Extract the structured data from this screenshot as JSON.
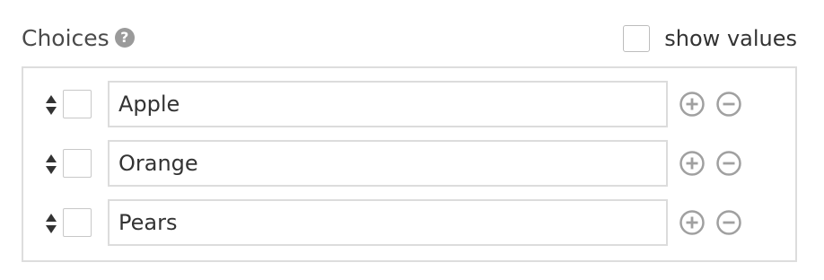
{
  "header": {
    "title": "Choices",
    "help_icon": "question-circle-icon"
  },
  "show_values": {
    "label": "show values",
    "checked": false
  },
  "choices": [
    {
      "value": "Apple",
      "checked": false
    },
    {
      "value": "Orange",
      "checked": false
    },
    {
      "value": "Pears",
      "checked": false
    }
  ],
  "icons": {
    "sort": "sort-icon",
    "add": "plus-circle-icon",
    "remove": "minus-circle-icon"
  },
  "colors": {
    "icon_gray": "#a0a0a0",
    "border": "#dddddd",
    "text": "#333333"
  }
}
